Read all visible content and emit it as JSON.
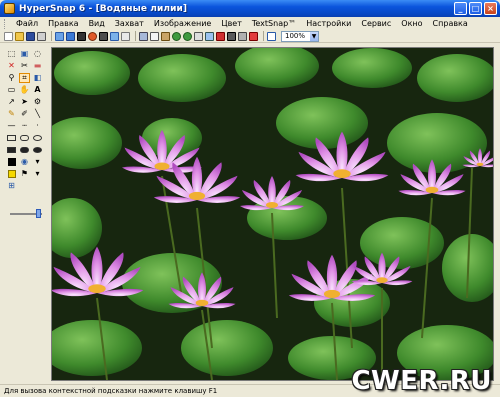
{
  "window": {
    "title": "HyperSnap 6 - [Водяные лилии]",
    "buttons": {
      "minimize": "_",
      "maximize": "□",
      "close": "×"
    }
  },
  "menu": {
    "items": [
      "Файл",
      "Правка",
      "Вид",
      "Захват",
      "Изображение",
      "Цвет",
      "TextSnap™",
      "Настройки",
      "Сервис",
      "Окно",
      "Справка"
    ]
  },
  "toolbar": {
    "zoom_value": "100%",
    "icons": [
      "new-icon",
      "open-icon",
      "save-icon",
      "print-icon",
      "capture-region-icon",
      "capture-window-icon",
      "capture-full-icon",
      "capture-button-icon",
      "capture-active-icon",
      "capture-scroll-icon",
      "repeat-capture-icon",
      "cut-icon",
      "copy-icon",
      "paste-icon",
      "undo-icon",
      "redo-icon",
      "crop-icon",
      "resize-icon",
      "rotate-icon",
      "mirror-icon",
      "grayscale-icon",
      "effects-icon",
      "help-icon"
    ]
  },
  "tools": {
    "icons": [
      "select-icon",
      "copy-select-icon",
      "lasso-icon",
      "delete-icon",
      "cut-icon",
      "eraser-icon",
      "zoom-icon",
      "crop-tool-icon",
      "paint-icon",
      "rectangle-select-icon",
      "hand-icon",
      "text-icon",
      "arrow-icon",
      "pointer-icon",
      "dropper-icon",
      "pencil-icon",
      "brush-icon",
      "line-icon"
    ]
  },
  "status": {
    "hint": "Для вызова контекстной подсказки нажмите клавишу F1"
  },
  "watermark": "CWER.RU",
  "colors": {
    "title_bar": "#0a54dc",
    "accent_orange": "#e28a00",
    "lotus_pink": "#d96ee0",
    "leaf_green": "#3f8a2c"
  }
}
